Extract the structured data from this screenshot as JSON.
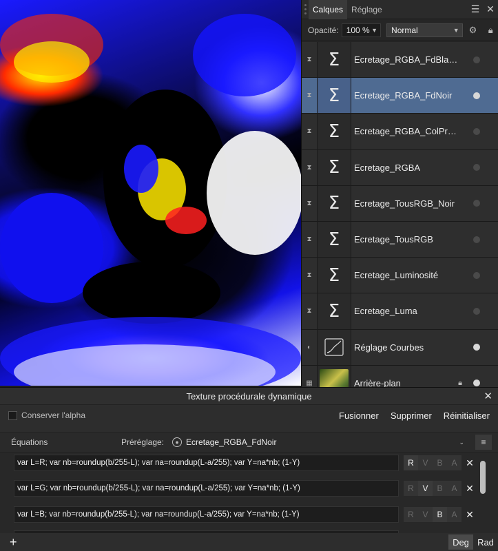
{
  "panel": {
    "tabs": [
      {
        "label": "Calques",
        "active": true
      },
      {
        "label": "Réglage",
        "active": false
      }
    ],
    "opacity_label": "Opacité:",
    "opacity_value": "100 %",
    "blend_mode": "Normal"
  },
  "layers": [
    {
      "name": "Ecretage_RGBA_FdBla…",
      "thumb": "sigma",
      "selected": false,
      "visible": false
    },
    {
      "name": "Ecretage_RGBA_FdNoir",
      "thumb": "sigma",
      "selected": true,
      "visible": true
    },
    {
      "name": "Ecretage_RGBA_ColPr…",
      "thumb": "sigma",
      "selected": false,
      "visible": false
    },
    {
      "name": "Ecretage_RGBA",
      "thumb": "sigma",
      "selected": false,
      "visible": false
    },
    {
      "name": "Ecretage_TousRGB_Noir",
      "thumb": "sigma",
      "selected": false,
      "visible": false
    },
    {
      "name": "Ecretage_TousRGB",
      "thumb": "sigma",
      "selected": false,
      "visible": false
    },
    {
      "name": "Ecretage_Luminosité",
      "thumb": "sigma",
      "selected": false,
      "visible": false
    },
    {
      "name": "Ecretage_Luma",
      "thumb": "sigma",
      "selected": false,
      "visible": false
    },
    {
      "name": "Réglage Courbes",
      "thumb": "curves",
      "selected": false,
      "visible": true
    },
    {
      "name": "Arrière-plan",
      "thumb": "photo",
      "selected": false,
      "visible": true,
      "locked": true
    }
  ],
  "dialog": {
    "title": "Texture procédurale dynamique",
    "preserve_alpha_label": "Conserver l'alpha",
    "buttons": {
      "merge": "Fusionner",
      "delete": "Supprimer",
      "reset": "Réinitialiser"
    },
    "equations_label": "Équations",
    "preset_label": "Préréglage:",
    "preset_value": "Ecretage_RGBA_FdNoir",
    "equations": [
      {
        "text": "var L=R; var nb=roundup(b/255-L); var na=roundup(L-a/255); var Y=na*nb; (1-Y)",
        "channels": {
          "R": true,
          "V": false,
          "B": false,
          "A": false
        }
      },
      {
        "text": "var L=G; var nb=roundup(b/255-L); var na=roundup(L-a/255); var Y=na*nb; (1-Y)",
        "channels": {
          "R": false,
          "V": true,
          "B": false,
          "A": false
        }
      },
      {
        "text": "var L=B; var nb=roundup(b/255-L); var na=roundup(L-a/255); var Y=na*nb; (1-Y)",
        "channels": {
          "R": false,
          "V": false,
          "B": true,
          "A": false
        }
      }
    ],
    "channel_labels": [
      "R",
      "V",
      "B",
      "A"
    ],
    "add_symbol": "+",
    "units": [
      {
        "label": "Deg",
        "active": true
      },
      {
        "label": "Rad",
        "active": false
      }
    ]
  }
}
